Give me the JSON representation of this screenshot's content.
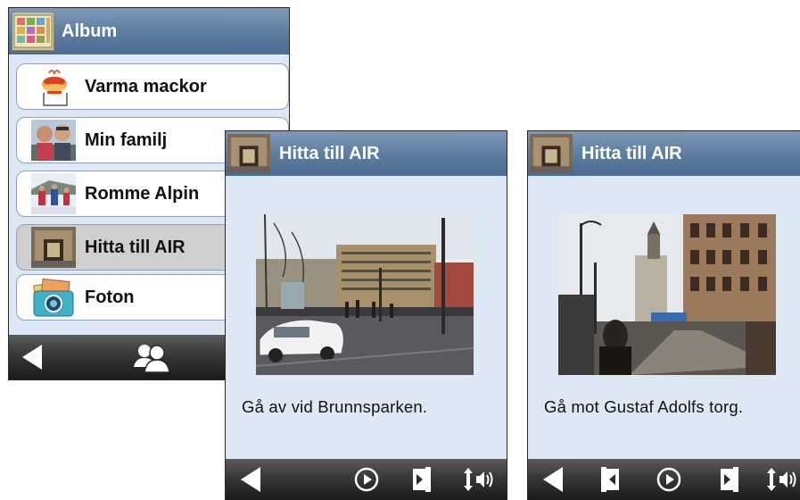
{
  "album_screen": {
    "title": "Album",
    "items": [
      {
        "label": "Varma mackor",
        "icon": "sandwich-icon"
      },
      {
        "label": "Min familj",
        "icon": "family-photo-icon"
      },
      {
        "label": "Romme Alpin",
        "icon": "ski-photo-icon"
      },
      {
        "label": "Hitta till AIR",
        "icon": "building-photo-icon",
        "selected": true
      },
      {
        "label": "Foton",
        "icon": "camera-icon"
      }
    ],
    "toolbar": [
      "back-icon",
      "contacts-icon"
    ]
  },
  "step_screen_1": {
    "title": "Hitta till AIR",
    "caption": "Gå av vid Brunnsparken.",
    "toolbar": [
      "back-icon",
      "play-icon",
      "next-page-icon",
      "volume-icon"
    ]
  },
  "step_screen_2": {
    "title": "Hitta till AIR",
    "caption": "Gå mot Gustaf Adolfs torg.",
    "toolbar": [
      "back-icon",
      "previous-page-icon",
      "play-icon",
      "next-page-icon",
      "volume-icon"
    ]
  },
  "colors": {
    "header": "#5c7b9f",
    "background": "#dde8f5",
    "toolbar": "#2b2b2b"
  }
}
